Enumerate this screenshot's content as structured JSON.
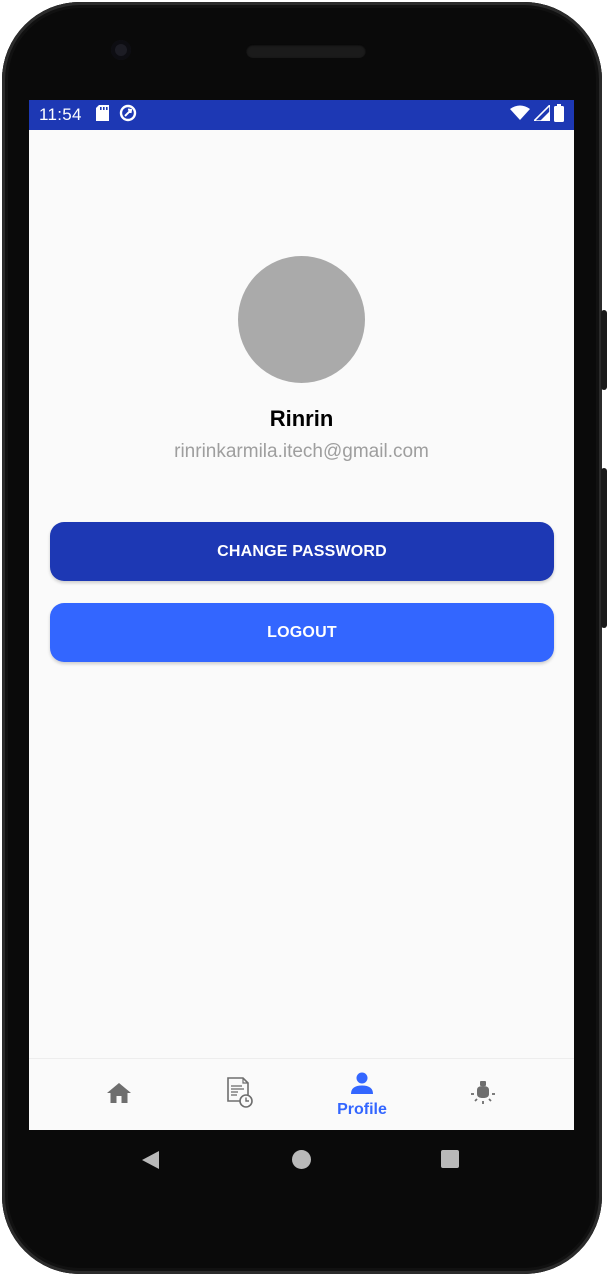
{
  "status_bar": {
    "time": "11:54",
    "left_icons": [
      "sd-card-icon",
      "data-saver-icon"
    ],
    "right_icons": [
      "wifi-icon",
      "cell-signal-icon",
      "battery-icon"
    ]
  },
  "profile": {
    "name": "Rinrin",
    "email": "rinrinkarmila.itech@gmail.com"
  },
  "actions": {
    "change_password_label": "CHANGE PASSWORD",
    "logout_label": "LOGOUT"
  },
  "bottom_nav": {
    "items": [
      {
        "icon": "home-icon",
        "label": "",
        "active": false
      },
      {
        "icon": "history-document-icon",
        "label": "",
        "active": false
      },
      {
        "icon": "person-icon",
        "label": "Profile",
        "active": true
      },
      {
        "icon": "lightbulb-icon",
        "label": "",
        "active": false
      }
    ]
  },
  "colors": {
    "primary_dark": "#1d38b4",
    "primary": "#3366ff",
    "background": "#fafafa",
    "avatar_placeholder": "#aaaaaa",
    "email_text": "#9e9e9e"
  }
}
